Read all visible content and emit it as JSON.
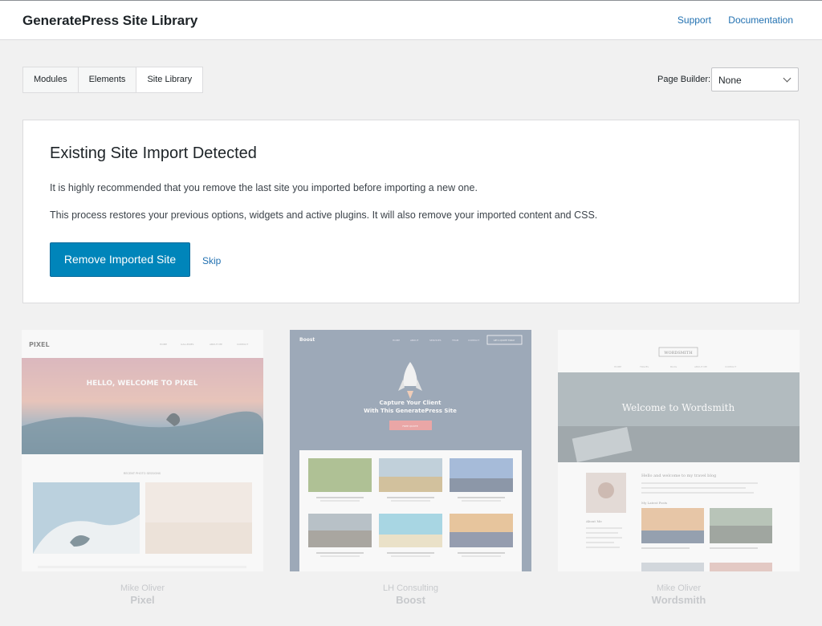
{
  "header": {
    "title": "GeneratePress Site Library",
    "support": "Support",
    "documentation": "Documentation"
  },
  "tabs": [
    {
      "label": "Modules"
    },
    {
      "label": "Elements"
    },
    {
      "label": "Site Library"
    }
  ],
  "page_builder": {
    "label": "Page Builder:",
    "value": "None"
  },
  "notice": {
    "heading": "Existing Site Import Detected",
    "line1": "It is highly recommended that you remove the last site you imported before importing a new one.",
    "line2": "This process restores your previous options, widgets and active plugins. It will also remove your imported content and CSS.",
    "remove_button": "Remove Imported Site",
    "skip": "Skip"
  },
  "sites": [
    {
      "author": "Mike Oliver",
      "name": "Pixel",
      "preview": {
        "logo": "PIXEL",
        "hero": "HELLO, WELCOME TO PIXEL",
        "section": "RECENT PHOTO SESSIONS",
        "nav": [
          "HOME",
          "GALLERIES",
          "ABOUT ME",
          "CONTACT"
        ]
      }
    },
    {
      "author": "LH Consulting",
      "name": "Boost",
      "preview": {
        "logo": "Boost",
        "hero_line1": "Capture Your Client",
        "hero_line2": "With This GeneratePress Site",
        "cta": "FREE QUOTE",
        "header_cta": "GET A QUOTE TODAY",
        "nav": [
          "HOME",
          "ABOUT",
          "SERVICES",
          "TEAM",
          "CONTACT"
        ]
      }
    },
    {
      "author": "Mike Oliver",
      "name": "Wordsmith",
      "preview": {
        "logo": "WORDSMITH",
        "hero": "Welcome to Wordsmith",
        "intro": "Hello and welcome to my travel blog",
        "section": "My Latest Posts",
        "about": "About Me",
        "nav": [
          "HOME",
          "TRAVEL",
          "BLOG",
          "ABOUT ME",
          "CONTACT"
        ]
      }
    }
  ]
}
